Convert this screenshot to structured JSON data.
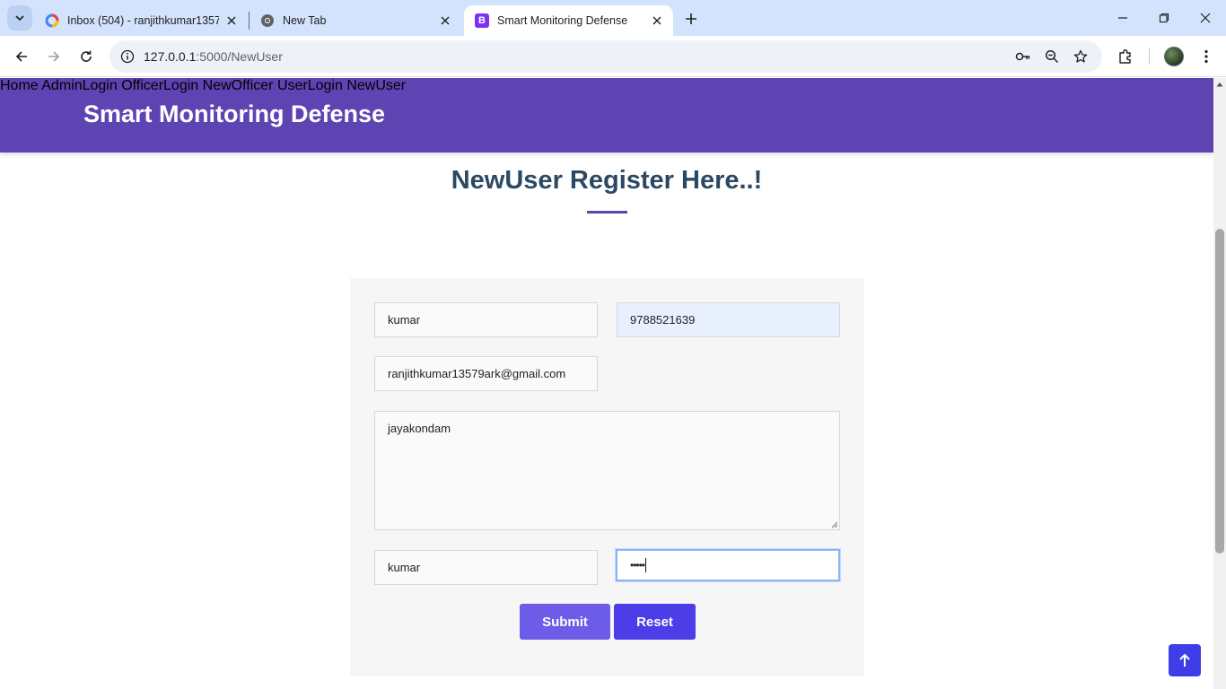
{
  "browser": {
    "tabs": [
      {
        "title": "Inbox (504) - ranjithkumar13579",
        "favicon": "gmail-icon",
        "active": false
      },
      {
        "title": "New Tab",
        "favicon": "chrome-icon",
        "active": false
      },
      {
        "title": "Smart Monitoring Defense",
        "favicon": "bootstrap-icon",
        "favicon_letter": "B",
        "active": true
      }
    ],
    "url_host": "127.0.0.1",
    "url_rest": ":5000/NewUser",
    "accent": "#d3e3fd"
  },
  "site": {
    "brand": "Smart Monitoring Defense",
    "brand_color": "#5e44b3",
    "nav": [
      "Home",
      "AdminLogin",
      "OfficerLogin",
      "NewOfficer",
      "UserLogin",
      "NewUser"
    ]
  },
  "page": {
    "title": "NewUser Register Here..!",
    "form": {
      "name_value": "kumar",
      "mobile_value": "9788521639",
      "email_value": "ranjithkumar13579ark@gmail.com",
      "address_value": "jayakondam",
      "username_value": "kumar",
      "password_mask": "•••••",
      "submit_label": "Submit",
      "reset_label": "Reset"
    },
    "back_to_top_icon": "arrow-up-icon"
  }
}
